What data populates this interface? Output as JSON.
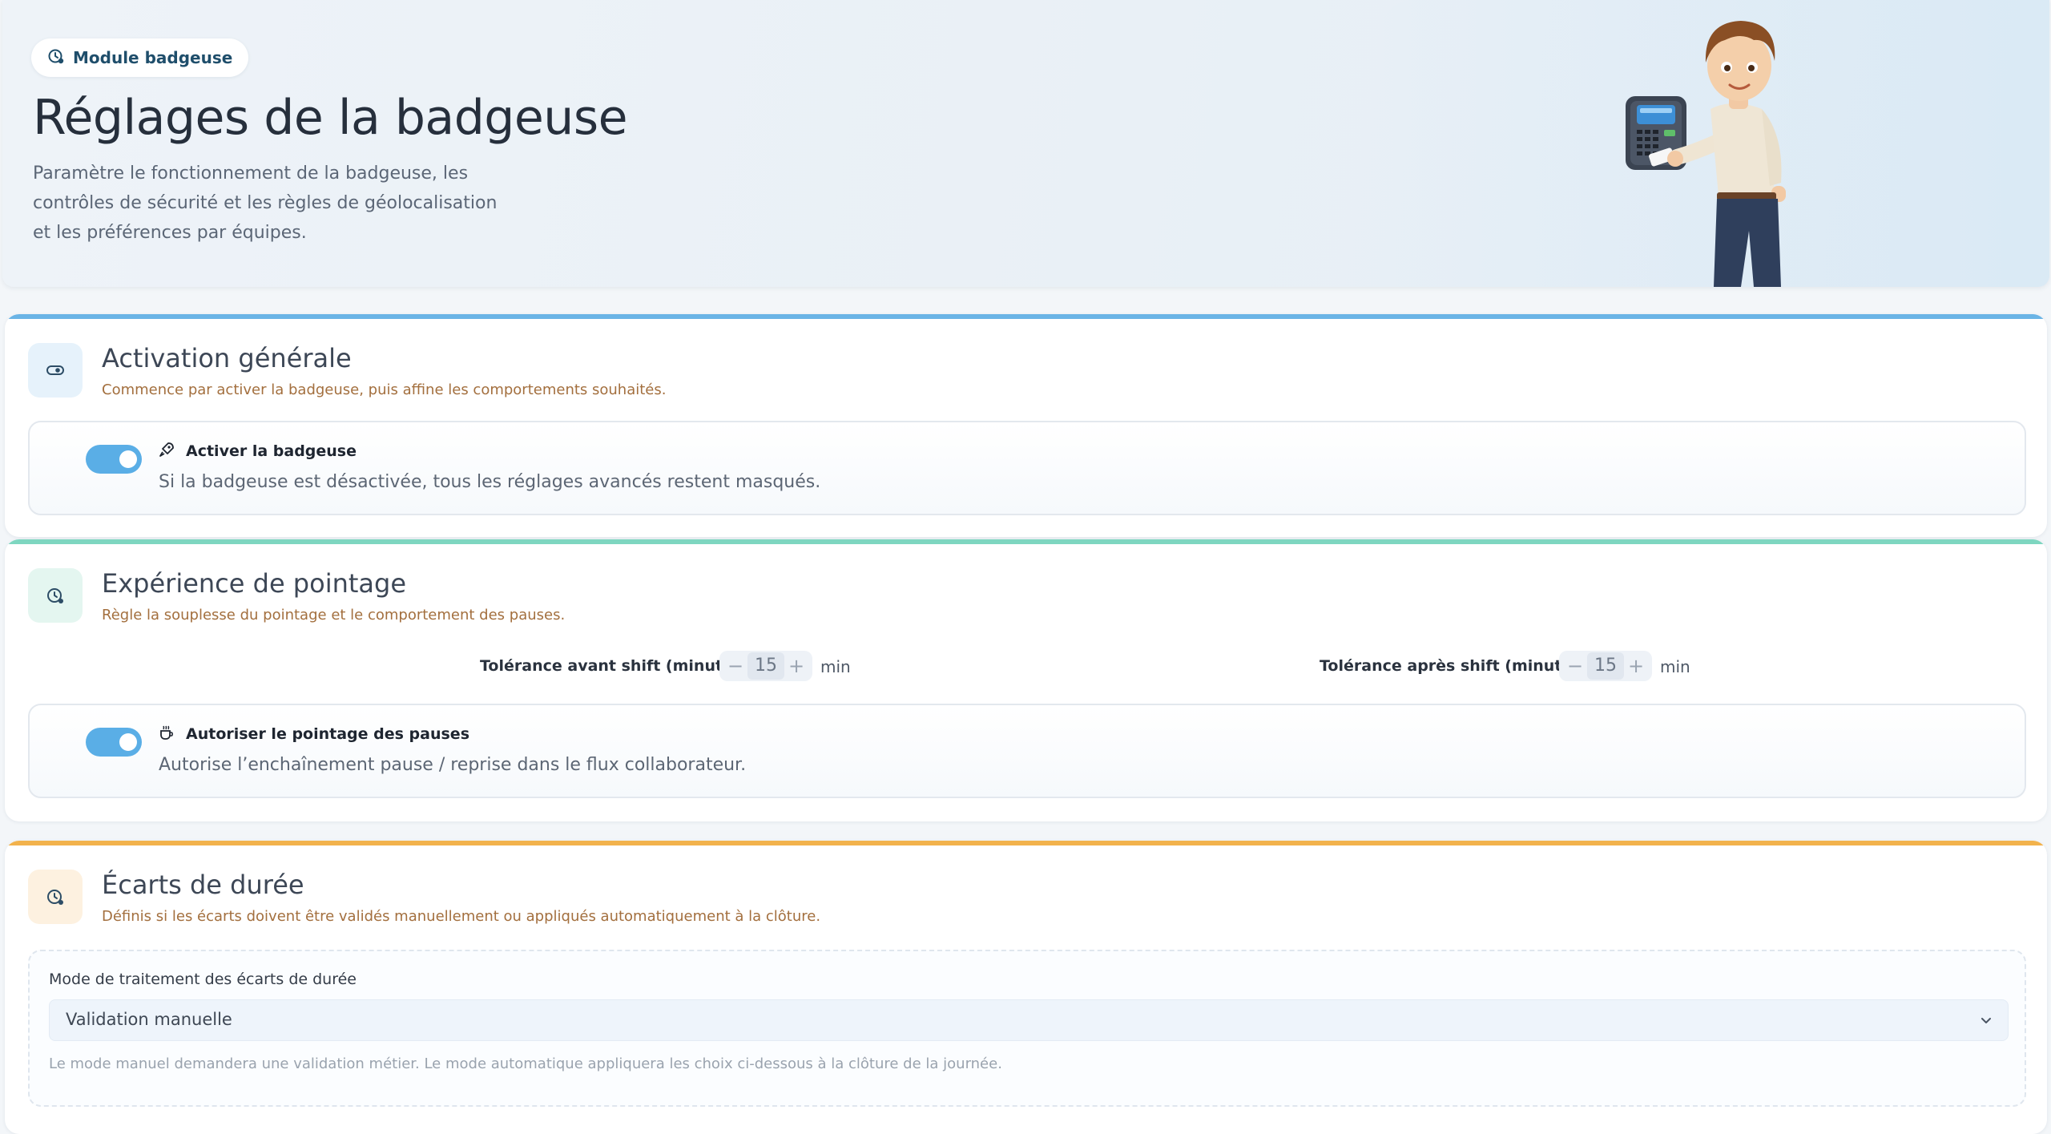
{
  "hero": {
    "badge_label": "Module badgeuse",
    "title": "Réglages de la badgeuse",
    "description": "Paramètre le fonctionnement de la badgeuse, les contrôles de sécurité et les règles de géolocalisation et les préférences par équipes."
  },
  "sections": {
    "activation": {
      "title": "Activation générale",
      "subtitle": "Commence par activer la badgeuse, puis affine les comportements souhaités.",
      "accent": "#6ab4e6",
      "option": {
        "label": "Activer la badgeuse",
        "description": "Si la badgeuse est désactivée, tous les réglages avancés restent masqués.",
        "enabled": true
      }
    },
    "experience": {
      "title": "Expérience de pointage",
      "subtitle": "Règle la souplesse du pointage et le comportement des pauses.",
      "accent": "#7ed6c0",
      "tolerance_before": {
        "label": "Tolérance avant shift (minutes)",
        "value": "15",
        "unit": "min"
      },
      "tolerance_after": {
        "label": "Tolérance après shift (minutes)",
        "value": "15",
        "unit": "min"
      },
      "option": {
        "label": "Autoriser le pointage des pauses",
        "description": "Autorise l’enchaînement pause / reprise dans le flux collaborateur.",
        "enabled": true
      }
    },
    "ecarts": {
      "title": "Écarts de durée",
      "subtitle": "Définis si les écarts doivent être validés manuellement ou appliqués automatiquement à la clôture.",
      "accent": "#f2b24c",
      "select_label": "Mode de traitement des écarts de durée",
      "select_value": "Validation manuelle",
      "hint": "Le mode manuel demandera une validation métier. Le mode automatique appliquera les choix ci-dessous à la clôture de la journée."
    }
  },
  "colors": {
    "toggle_on": "#5aaee6",
    "subtitle": "#a36f3e"
  }
}
